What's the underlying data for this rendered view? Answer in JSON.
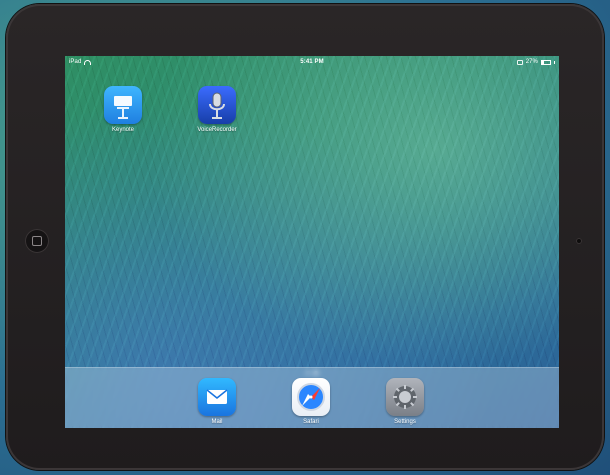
{
  "status_bar": {
    "carrier": "iPad",
    "time": "5:41 PM",
    "battery_percent": "27%"
  },
  "home_screen": {
    "apps": [
      {
        "label": "Keynote"
      },
      {
        "label": "VoiceRecorder"
      }
    ],
    "page_dots": {
      "count": 2,
      "active_index": 1
    }
  },
  "dock": {
    "apps": [
      {
        "label": "Mail"
      },
      {
        "label": "Safari"
      },
      {
        "label": "Settings"
      }
    ]
  },
  "icons": {
    "wifi": "wifi-icon",
    "battery": "battery-icon",
    "bluetooth": "bluetooth-icon",
    "home": "home-button-icon",
    "camera": "front-camera-icon"
  },
  "colors": {
    "mail_blue": "#1a74df",
    "keynote_blue": "#1f7fe0",
    "voicerecorder_blue": "#173ea8",
    "settings_gray": "#7a7f87"
  }
}
